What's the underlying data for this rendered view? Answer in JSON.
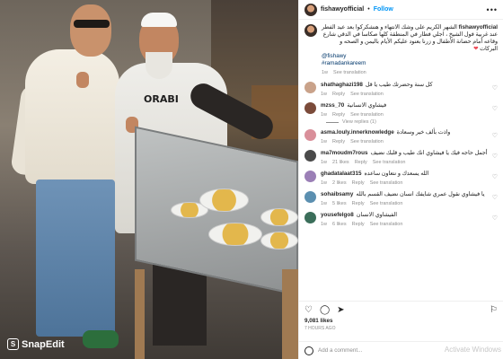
{
  "post": {
    "username": "fishawyofficial",
    "follow_label": "Follow",
    "more_icon": "more-horizontal-icon",
    "caption": {
      "author": "fishawyofficial",
      "text": "الشهر الكريم على وشك الانتهاء و هنشكركوا بعد عيد الفطر عند غربية فول الشيخ ، اجلي فطار في المنطقة كلها صكاسا في الدقي شارع وقاعه أمام حضانة الأطفال و زرنا بعنود عليكم الأيام باليمن و الصحه و البركات",
      "mention1": "fishawy",
      "mention2": "ramadankareem",
      "time": "1w",
      "see_translation": "See translation"
    },
    "comments": [
      {
        "username": "shathaghazi198",
        "text": "كل سنة وحضرتك طيب يا قل",
        "time": "1w",
        "reply": "Reply",
        "see_translation": "See translation",
        "likes": ""
      },
      {
        "username": "mzss_70",
        "text": "فيشاوي الانسانية",
        "time": "1w",
        "reply": "Reply",
        "see_translation": "See translation",
        "likes": "",
        "view_replies": "View replies (1)"
      },
      {
        "username": "asma.louly.innerknowledge",
        "text": "واذت بألف خير وسعادة",
        "time": "1w",
        "reply": "Reply",
        "see_translation": "See translation",
        "likes": ""
      },
      {
        "username": "ma7moudm7rous",
        "text": "أجمل حاجه فيك يا فيشاوي انك طيب و قلبك نضيف",
        "time": "1w",
        "reply": "Reply",
        "see_translation": "See translation",
        "likes": "21 likes"
      },
      {
        "username": "ghadatalaat315",
        "text": "الله يسعدك و نتعاون ساعده",
        "time": "1w",
        "reply": "Reply",
        "see_translation": "See translation",
        "likes": "2 likes"
      },
      {
        "username": "sohaibsamy",
        "text": "يا فيشاوي نقول عمري شايفك انسان نضيف القسم بالله",
        "time": "1w",
        "reply": "Reply",
        "see_translation": "See translation",
        "likes": "5 likes"
      },
      {
        "username": "yousefelgo8",
        "text": "الفيشاوي الانسان",
        "time": "1w",
        "reply": "Reply",
        "see_translation": "See translation",
        "likes": "6 likes"
      }
    ],
    "likes_count": "9,081 likes",
    "posted_time": "7 HOURS AGO",
    "add_comment_placeholder": "Add a comment..."
  },
  "photo": {
    "apron_text": "ORABI",
    "watermark": "SnapEdit"
  },
  "side_watermark": "Activate Windows"
}
